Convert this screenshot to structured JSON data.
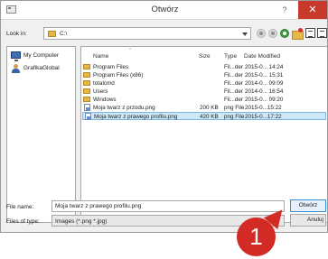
{
  "window": {
    "title": "Otwórz",
    "help_label": "?",
    "close_label": "✕"
  },
  "toolbar": {
    "look_in_label": "Look in:",
    "look_in_value": "C:\\",
    "icons": [
      "back-icon",
      "forward-icon",
      "up-icon",
      "new-folder-icon",
      "list-view-icon",
      "detail-view-icon"
    ]
  },
  "sidebar": {
    "items": [
      {
        "label": "My Computer",
        "icon": "computer-icon"
      },
      {
        "label": "GrafikaGlobal",
        "icon": "user-icon"
      }
    ]
  },
  "filelist": {
    "columns": [
      "Name",
      "Size",
      "Type",
      "Date Modified"
    ],
    "rows": [
      {
        "name": "Program Files",
        "size": "",
        "type": "Fil...der",
        "date": "2015-0... 14:24",
        "icon": "folder-icon"
      },
      {
        "name": "Program Files (x86)",
        "size": "",
        "type": "Fil...der",
        "date": "2015-0... 15:31",
        "icon": "folder-icon"
      },
      {
        "name": "totalcmd",
        "size": "",
        "type": "Fil...der",
        "date": "2014-0... 09:09",
        "icon": "folder-icon"
      },
      {
        "name": "Users",
        "size": "",
        "type": "Fil...der",
        "date": "2014-0... 16:54",
        "icon": "folder-icon"
      },
      {
        "name": "Windows",
        "size": "",
        "type": "Fil...der",
        "date": "2015-0... 09:20",
        "icon": "folder-icon"
      },
      {
        "name": "Moja twarz z przodu.png",
        "size": "200 KB",
        "type": "png File",
        "date": "2015-0...15:22",
        "icon": "image-file-icon"
      },
      {
        "name": "Moja twarz z prawego profilu.png",
        "size": "420 KB",
        "type": "png File",
        "date": "2015-0...17:22",
        "icon": "image-file-icon",
        "selected": true
      }
    ]
  },
  "footer": {
    "file_name_label": "File name:",
    "file_name_value": "Moja twarz z prawego profilu.png",
    "file_type_label": "Files of type:",
    "file_type_value": "Images (*.png *.jpg)",
    "open_label": "Otwórz",
    "cancel_label": "Anuluj"
  },
  "callout": {
    "number": "1",
    "color": "#d22b26"
  },
  "colors": {
    "close_button": "#c7392b",
    "selection": "#cde8f8",
    "open_button_border": "#3b8fd8"
  }
}
